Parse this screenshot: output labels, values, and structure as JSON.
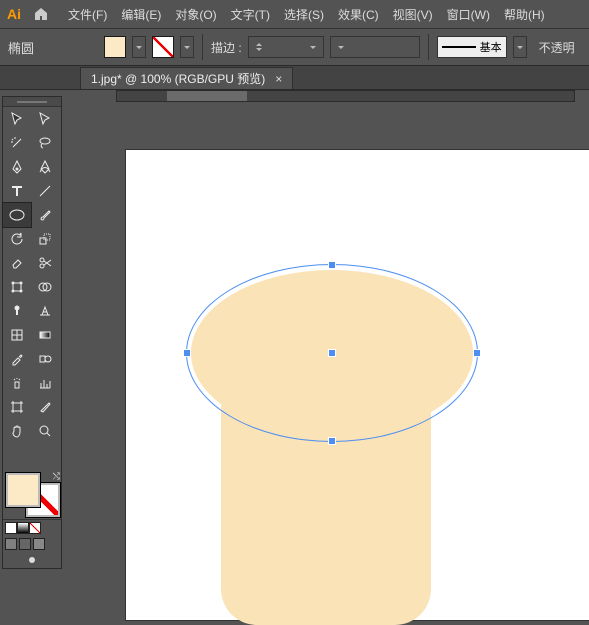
{
  "app": {
    "logo": "Ai"
  },
  "menu": {
    "file": "文件(F)",
    "edit": "编辑(E)",
    "object": "对象(O)",
    "type": "文字(T)",
    "select": "选择(S)",
    "effect": "效果(C)",
    "view": "视图(V)",
    "window": "窗口(W)",
    "help": "帮助(H)"
  },
  "control": {
    "tool_label": "椭圆",
    "stroke_label": "描边 :",
    "stroke_value": "",
    "stroke_style_label": "基本",
    "opacity_trunc": "不透明"
  },
  "tabs": {
    "doc1": "1.jpg* @ 100% (RGB/GPU 预览)"
  },
  "tools": {
    "row": [
      "selection",
      "direct-sel",
      "wand",
      "lasso",
      "pen",
      "curvature",
      "type",
      "line",
      "ellipse",
      "brush",
      "rotate",
      "scale",
      "eraser",
      "scissors",
      "free-transform",
      "shape-builder",
      "pin",
      "perspective",
      "mesh",
      "gradient",
      "eyedropper",
      "blend",
      "symbol",
      "graph",
      "artboard",
      "slice",
      "hand",
      "zoom"
    ]
  },
  "canvas": {
    "bg": "#ffffff",
    "shape_color": "#fbe3b8",
    "selection_color": "#4c8ef2"
  }
}
